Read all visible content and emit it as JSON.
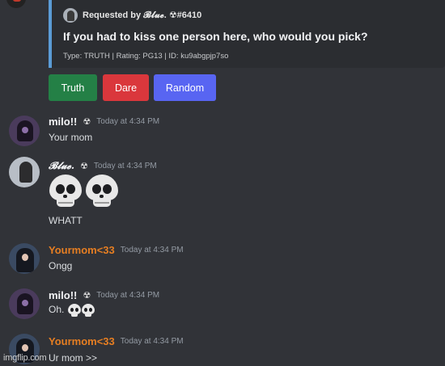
{
  "embed": {
    "author": "Requested by 𝓑𝓵𝓾𝓮. ☢#6410",
    "title": "If you had to kiss one person here, who would you pick?",
    "footer": "Type: TRUTH | Rating: PG13 | ID: ku9abgpjp7so"
  },
  "buttons": {
    "truth": "Truth",
    "dare": "Dare",
    "random": "Random"
  },
  "messages": [
    {
      "username": "milo!!",
      "user_icon": "☢",
      "timestamp": "Today at 4:34 PM",
      "text": "Your mom"
    },
    {
      "username": "𝓑𝓵𝓾𝓮.",
      "user_icon": "☢",
      "timestamp": "Today at 4:34 PM",
      "emoji": [
        "skull",
        "skull"
      ],
      "text": "WHATT"
    },
    {
      "username": "Yourmom<33",
      "timestamp": "Today at 4:34 PM",
      "text": "Ongg"
    },
    {
      "username": "milo!!",
      "user_icon": "☢",
      "timestamp": "Today at 4:34 PM",
      "text": "Oh.",
      "emoji": [
        "skull",
        "skull"
      ]
    },
    {
      "username": "Yourmom<33",
      "timestamp": "Today at 4:34 PM",
      "text": "Ur mom >>"
    }
  ],
  "colors": {
    "background": "#313338",
    "embed_bar": "#5b9cd6",
    "truth": "#248046",
    "dare": "#da373c",
    "random": "#5865f2",
    "orange_name": "#e67e22"
  },
  "watermark": "imgflip.com"
}
